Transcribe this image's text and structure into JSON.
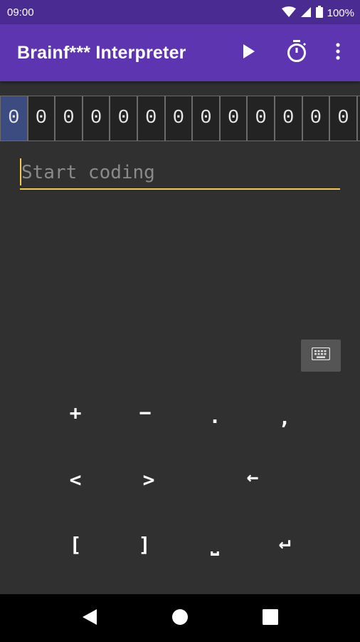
{
  "status_bar": {
    "time": "09:00",
    "battery": "100%",
    "icons": [
      "wifi-icon",
      "signal-icon",
      "battery-icon"
    ]
  },
  "app_bar": {
    "title": "Brainf*** Interpreter",
    "actions": [
      "play-icon",
      "timer-icon",
      "more-vert-icon"
    ],
    "color": "#5e35b1"
  },
  "tape": {
    "cells": [
      "0",
      "0",
      "0",
      "0",
      "0",
      "0",
      "0",
      "0",
      "0",
      "0",
      "0",
      "0",
      "0",
      "0"
    ],
    "active_index": 0,
    "active_color": "#3c4b80"
  },
  "editor": {
    "placeholder": "Start coding",
    "value": "",
    "accent_color": "#f2c94c"
  },
  "keyboard_toggle": {
    "icon": "keyboard-icon"
  },
  "keys": {
    "plus": "+",
    "minus": "−",
    "dot": ".",
    "comma": ",",
    "less": "<",
    "greater": ">",
    "backspace": "←",
    "open_bracket": "[",
    "close_bracket": "]",
    "space": "⎵",
    "enter": "↵"
  },
  "nav_bar": {
    "buttons": [
      "back-icon",
      "home-icon",
      "recents-icon"
    ]
  }
}
